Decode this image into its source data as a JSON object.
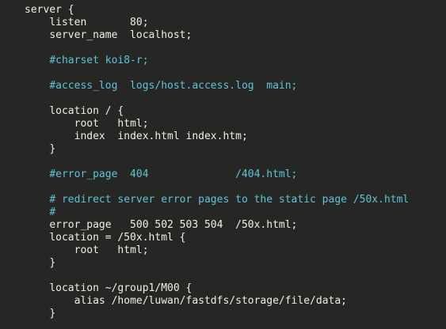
{
  "code_lines": [
    {
      "indent": "",
      "text": "server {",
      "kind": "plain"
    },
    {
      "indent": "    ",
      "text": "listen       80;",
      "kind": "plain"
    },
    {
      "indent": "    ",
      "text": "server_name  localhost;",
      "kind": "plain"
    },
    {
      "indent": "",
      "text": "",
      "kind": "plain"
    },
    {
      "indent": "    ",
      "text": "#charset koi8-r;",
      "kind": "comment"
    },
    {
      "indent": "",
      "text": "",
      "kind": "plain"
    },
    {
      "indent": "    ",
      "text": "#access_log  logs/host.access.log  main;",
      "kind": "comment"
    },
    {
      "indent": "",
      "text": "",
      "kind": "plain"
    },
    {
      "indent": "    ",
      "text": "location / {",
      "kind": "plain"
    },
    {
      "indent": "        ",
      "text": "root   html;",
      "kind": "plain"
    },
    {
      "indent": "        ",
      "text": "index  index.html index.htm;",
      "kind": "plain"
    },
    {
      "indent": "    ",
      "text": "}",
      "kind": "plain"
    },
    {
      "indent": "",
      "text": "",
      "kind": "plain"
    },
    {
      "indent": "    ",
      "text": "#error_page  404              /404.html;",
      "kind": "comment"
    },
    {
      "indent": "",
      "text": "",
      "kind": "plain"
    },
    {
      "indent": "    ",
      "text": "# redirect server error pages to the static page /50x.html",
      "kind": "comment"
    },
    {
      "indent": "    ",
      "text": "#",
      "kind": "comment"
    },
    {
      "indent": "    ",
      "text": "error_page   500 502 503 504  /50x.html;",
      "kind": "plain"
    },
    {
      "indent": "    ",
      "text": "location = /50x.html {",
      "kind": "plain"
    },
    {
      "indent": "        ",
      "text": "root   html;",
      "kind": "plain"
    },
    {
      "indent": "    ",
      "text": "}",
      "kind": "plain"
    },
    {
      "indent": "",
      "text": "",
      "kind": "plain"
    },
    {
      "indent": "    ",
      "text": "location ~/group1/M00 {",
      "kind": "plain"
    },
    {
      "indent": "        ",
      "text": "alias /home/luwan/fastdfs/storage/file/data;",
      "kind": "plain"
    },
    {
      "indent": "    ",
      "text": "}",
      "kind": "plain"
    }
  ],
  "colors": {
    "background": "#262724",
    "text": "#eeeee8",
    "comment": "#5ec4d8"
  }
}
